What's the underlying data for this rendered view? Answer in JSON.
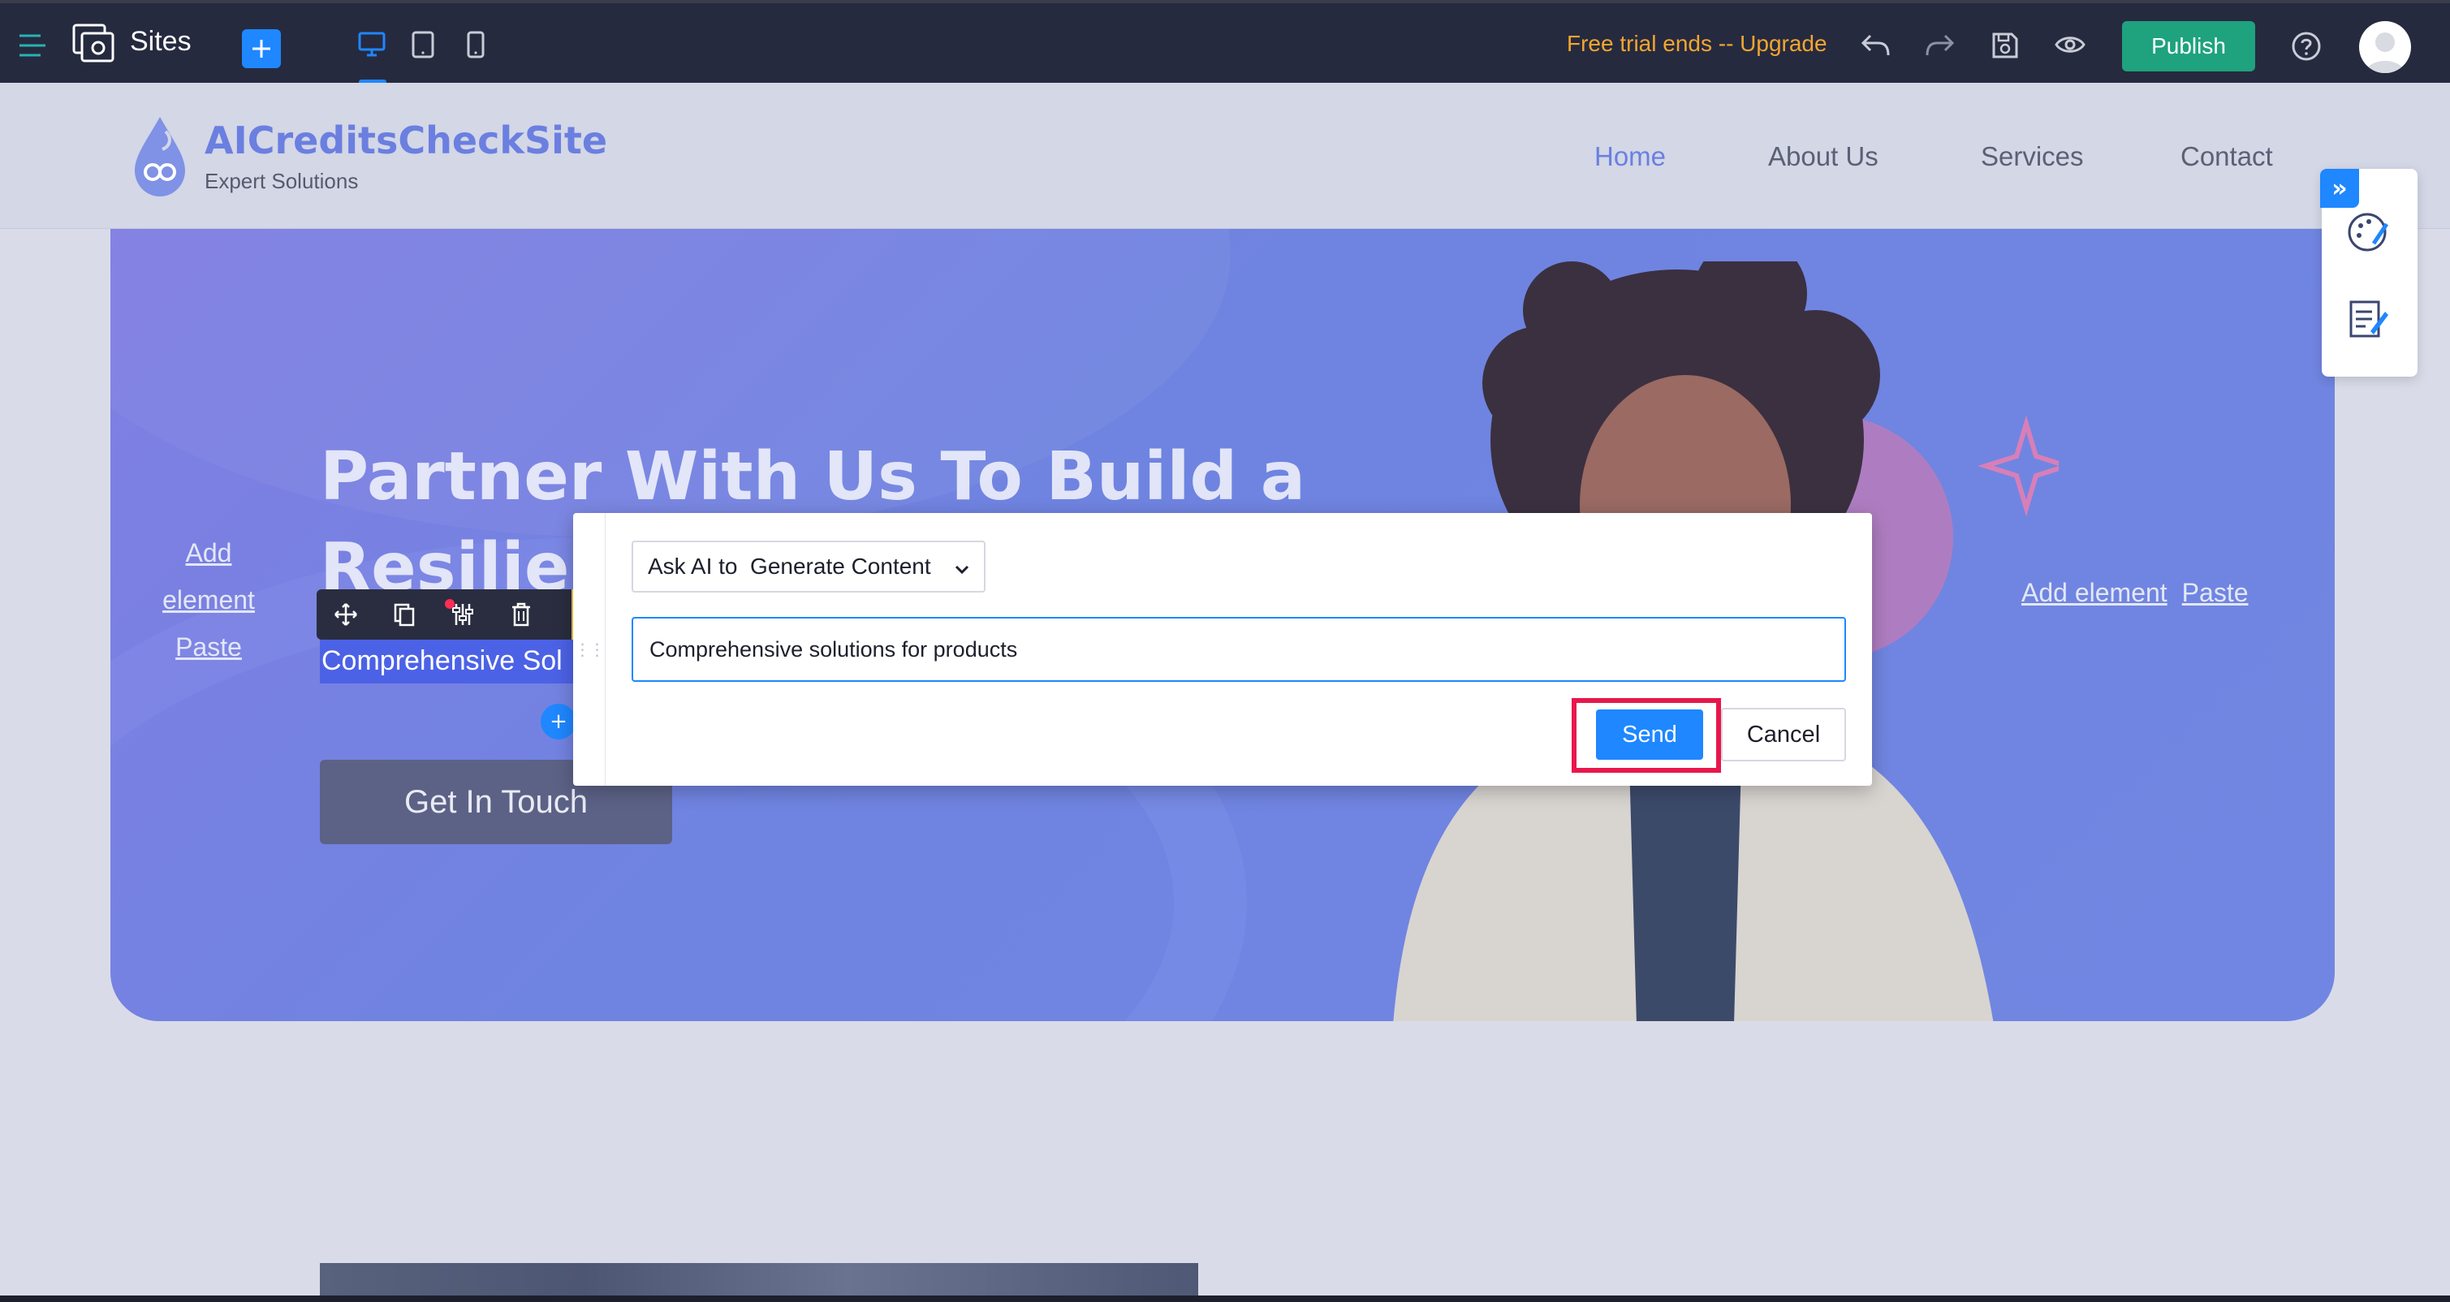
{
  "topbar": {
    "app_name": "Sites",
    "trial_text": "Free trial ends -- Upgrade",
    "publish_label": "Publish",
    "icons": [
      "menu-icon",
      "sites-logo-icon",
      "add-icon",
      "desktop-icon",
      "tablet-icon",
      "mobile-icon",
      "undo-icon",
      "redo-icon",
      "save-icon",
      "preview-icon",
      "help-icon",
      "avatar"
    ]
  },
  "site": {
    "brand": "AICreditsCheckSite",
    "tagline": "Expert Solutions",
    "nav": [
      {
        "label": "Home",
        "active": true
      },
      {
        "label": "About Us"
      },
      {
        "label": "Services"
      },
      {
        "label": "Contact"
      }
    ]
  },
  "hero": {
    "headline_line1": "Partner With Us To Build a",
    "headline_line2": "Resilien",
    "subtitle_visible": "Comprehensive Sol",
    "cta_label": "Get In Touch",
    "add_element_left": [
      "Add",
      "element",
      "Paste"
    ],
    "add_element_right": "Add element",
    "paste_right": "Paste"
  },
  "dialog": {
    "mode_label": "Ask AI to  Generate Content",
    "prompt_value": "Comprehensive solutions for products",
    "send_label": "Send",
    "cancel_label": "Cancel"
  },
  "colors": {
    "topbar_bg": "#262a3f",
    "accent_blue": "#1f87ff",
    "publish_green": "#1fa27e",
    "trial_orange": "#f3a62f",
    "highlight_red": "#e8174c",
    "hero_bg": "#6f84e0"
  }
}
